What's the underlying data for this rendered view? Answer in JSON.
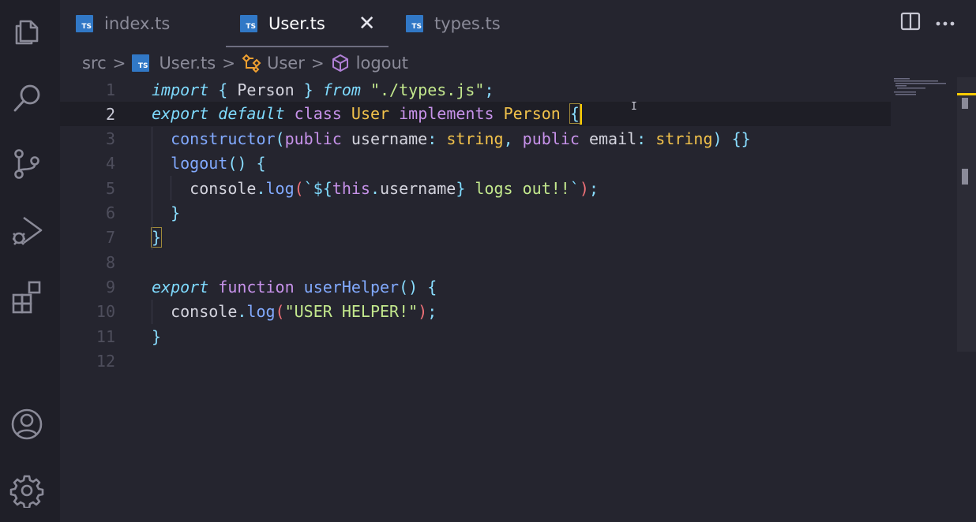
{
  "activity_bar": {
    "icons": [
      "files-icon",
      "search-icon",
      "source-control-icon",
      "run-debug-icon",
      "extensions-icon",
      "account-icon",
      "settings-gear-icon"
    ]
  },
  "tabs": [
    {
      "label": "index.ts",
      "badge": "TS"
    },
    {
      "label": "User.ts",
      "badge": "TS",
      "active": true
    },
    {
      "label": "types.ts",
      "badge": "TS"
    }
  ],
  "breadcrumb": {
    "folder": "src",
    "file": "User.ts",
    "class": "User",
    "method": "logout"
  },
  "editor": {
    "line_numbers": [
      "1",
      "2",
      "3",
      "4",
      "5",
      "6",
      "7",
      "8",
      "9",
      "10",
      "11",
      "12"
    ],
    "current_line": 2,
    "lines": [
      [
        [
          "kw-it",
          "import"
        ],
        [
          "pun",
          " { "
        ],
        [
          "plain",
          "Person"
        ],
        [
          "pun",
          " } "
        ],
        [
          "kw-it",
          "from"
        ],
        [
          "plain",
          " "
        ],
        [
          "str",
          "\"./types.js\""
        ],
        [
          "pun",
          ";"
        ]
      ],
      [
        [
          "kw-it",
          "export"
        ],
        [
          "plain",
          " "
        ],
        [
          "kw-it",
          "default"
        ],
        [
          "plain",
          " "
        ],
        [
          "kw",
          "class"
        ],
        [
          "plain",
          " "
        ],
        [
          "type",
          "User"
        ],
        [
          "plain",
          " "
        ],
        [
          "kw",
          "implements"
        ],
        [
          "plain",
          " "
        ],
        [
          "type",
          "Person"
        ],
        [
          "plain",
          " "
        ],
        [
          "pun",
          "{"
        ]
      ],
      [
        [
          "plain",
          "  "
        ],
        [
          "fn",
          "constructor"
        ],
        [
          "pun",
          "("
        ],
        [
          "kw",
          "public"
        ],
        [
          "plain",
          " username"
        ],
        [
          "pun",
          ": "
        ],
        [
          "type",
          "string"
        ],
        [
          "pun",
          ", "
        ],
        [
          "kw",
          "public"
        ],
        [
          "plain",
          " email"
        ],
        [
          "pun",
          ": "
        ],
        [
          "type",
          "string"
        ],
        [
          "pun",
          ") {}"
        ]
      ],
      [
        [
          "plain",
          "  "
        ],
        [
          "fn",
          "logout"
        ],
        [
          "pun",
          "() {"
        ]
      ],
      [
        [
          "plain",
          "    console"
        ],
        [
          "pun",
          "."
        ],
        [
          "fn",
          "log"
        ],
        [
          "paren",
          "("
        ],
        [
          "tpl",
          "`${"
        ],
        [
          "kw",
          "this"
        ],
        [
          "pun",
          "."
        ],
        [
          "plain",
          "username"
        ],
        [
          "tpl",
          "}"
        ],
        [
          "str",
          " logs out!!"
        ],
        [
          "tpl",
          "`"
        ],
        [
          "paren",
          ")"
        ],
        [
          "pun",
          ";"
        ]
      ],
      [
        [
          "plain",
          "  "
        ],
        [
          "pun",
          "}"
        ]
      ],
      [
        [
          "pun",
          "}"
        ]
      ],
      [],
      [
        [
          "kw-it",
          "export"
        ],
        [
          "plain",
          " "
        ],
        [
          "kw",
          "function"
        ],
        [
          "plain",
          " "
        ],
        [
          "fn",
          "userHelper"
        ],
        [
          "pun",
          "() {"
        ]
      ],
      [
        [
          "plain",
          "  console"
        ],
        [
          "pun",
          "."
        ],
        [
          "fn",
          "log"
        ],
        [
          "paren",
          "("
        ],
        [
          "str",
          "\"USER HELPER!\""
        ],
        [
          "paren",
          ")"
        ],
        [
          "pun",
          ";"
        ]
      ],
      [
        [
          "pun",
          "}"
        ]
      ],
      []
    ]
  }
}
